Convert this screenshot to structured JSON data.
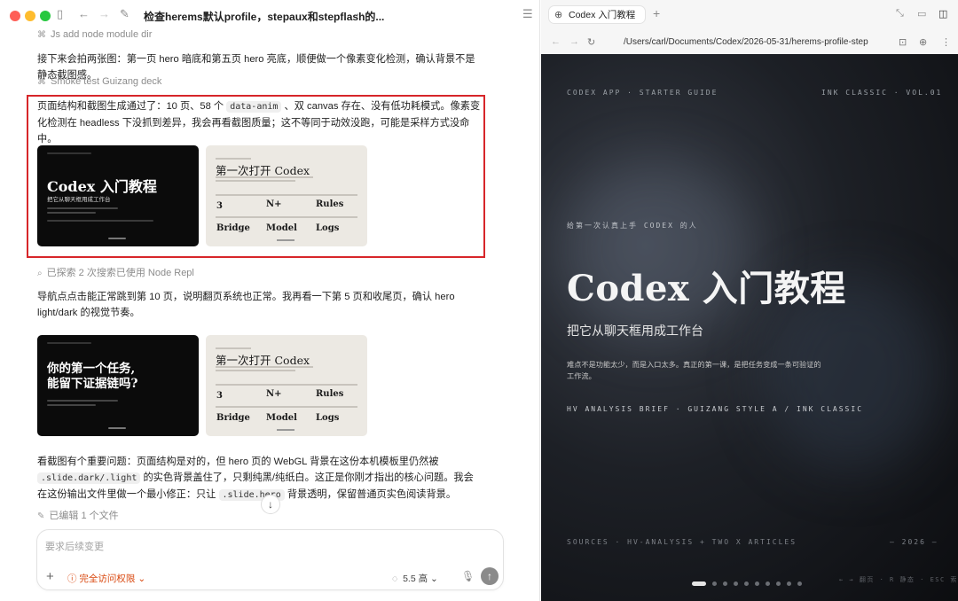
{
  "left": {
    "thread_title": "检查herems默认profile，stepaux和stepflash的...",
    "more_label": "···",
    "step1": "Js add node module dir",
    "para1": "接下来会拍两张图：第一页 hero 暗底和第五页 hero 亮底，顺便做一个像素变化检测，确认背景不是静态截图感。",
    "step2": "Smoke test Guizang deck",
    "para2_a": "页面结构和截图生成通过了：10 页、58 个",
    "para2_code": "data-anim",
    "para2_b": "、双 canvas 存在、没有低功耗模式。像素变化检测在 headless 下没抓到差异，我会再看截图质量；这不等同于动效没跑，可能是采样方式没命中。",
    "step3": "已探索 2 次搜索已使用 Node Repl",
    "para3": "导航点点击能正常跳到第 10 页，说明翻页系统也正常。我再看一下第 5 页和收尾页，确认 hero light/dark 的视觉节奏。",
    "para4_a": "看截图有个重要问题：页面结构是对的，但 hero 页的 WebGL 背景在这份本机模板里仍然被",
    "para4_code1": ".slide.dark/.light",
    "para4_b": "的实色背景盖住了，只剩纯黑/纯纸白。这正是你刚才指出的核心问题。我会在这份输出文件里做一个最小修正：只让",
    "para4_code2": ".slide.hero",
    "para4_c": "背景透明，保留普通页实色阅读背景。",
    "step4": "已编辑 1 个文件",
    "thumbs": {
      "dark1_title": "Codex 入门教程",
      "dark1_sub": "把它从聊天框用成工作台",
      "light_title": "第一次打开 Codex",
      "grid": [
        "3",
        "N+",
        "Rules",
        "Bridge",
        "Model",
        "Logs"
      ],
      "dark2_title_l1": "你的第一个任务,",
      "dark2_title_l2": "能留下证据链吗?"
    },
    "composer": {
      "placeholder": "要求后续变更",
      "permission": "完全访问权限",
      "model": "5.5 高"
    }
  },
  "right": {
    "tab_label": "Codex 入门教程",
    "url": "/Users/carl/Documents/Codex/2026-05-31/herems-profile-step",
    "slide": {
      "header_left": "CODEX APP · STARTER GUIDE",
      "header_right": "INK CLASSIC · VOL.01",
      "kicker": "给第一次认真上手 CODEX 的人",
      "title": "Codex 入门教程",
      "subtitle": "把它从聊天框用成工作台",
      "body": "难点不是功能太少，而是入口太多。真正的第一课，是把任务变成一条可验证的工作流。",
      "tagline": "HV ANALYSIS BRIEF  ·  GUIZANG STYLE A / INK CLASSIC",
      "footer_left": "SOURCES · HV-ANALYSIS + TWO X ARTICLES",
      "footer_right": "— 2026 —",
      "nav_hint": "← → 翻页 · R 静态 · ESC 索引",
      "page_count": 10,
      "current_page": 1
    }
  },
  "colors": {
    "highlight_border": "#d7262a",
    "permission": "#d9480f"
  }
}
